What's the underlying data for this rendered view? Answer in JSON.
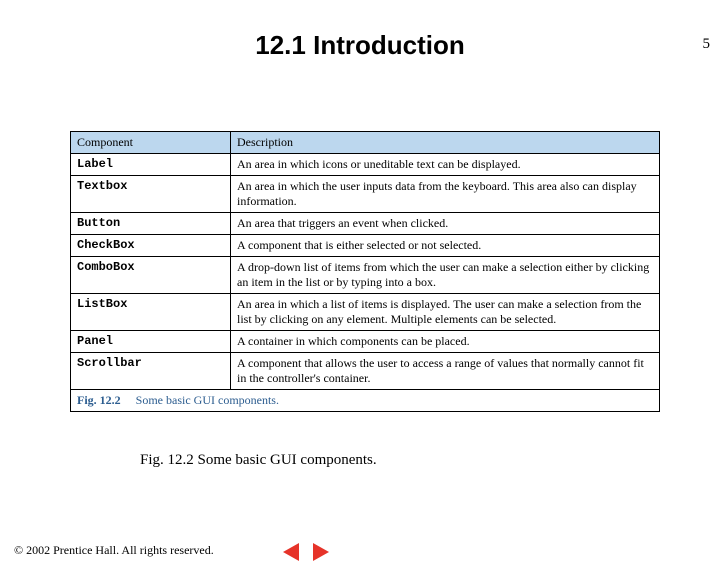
{
  "page_number": "5",
  "heading": "12.1   Introduction",
  "table": {
    "headers": {
      "component": "Component",
      "description": "Description"
    },
    "rows": [
      {
        "component": "Label",
        "description": "An area in which icons or uneditable text can be displayed."
      },
      {
        "component": "Textbox",
        "description": "An area in which the user inputs data from the keyboard.  This area also can display information."
      },
      {
        "component": "Button",
        "description": "An area that triggers an event when clicked."
      },
      {
        "component": "CheckBox",
        "description": "A component that is either selected or not selected."
      },
      {
        "component": "ComboBox",
        "description": "A drop-down list of items from which the user can make a selection either by clicking an item in the list or by typing into a box."
      },
      {
        "component": "ListBox",
        "description": "An area in which a list of items is displayed. The user can make a selection from the list by clicking on any element. Multiple elements can be selected."
      },
      {
        "component": "Panel",
        "description": "A container in which components can be placed."
      },
      {
        "component": "Scrollbar",
        "description": "A component that allows the user to access a range of values that normally cannot fit in the controller's container."
      }
    ],
    "figure_label": {
      "strong": "Fig. 12.2",
      "rest": "Some basic GUI components."
    }
  },
  "caption": "Fig. 12.2   Some basic GUI components.",
  "footer": "© 2002 Prentice Hall.  All rights reserved."
}
